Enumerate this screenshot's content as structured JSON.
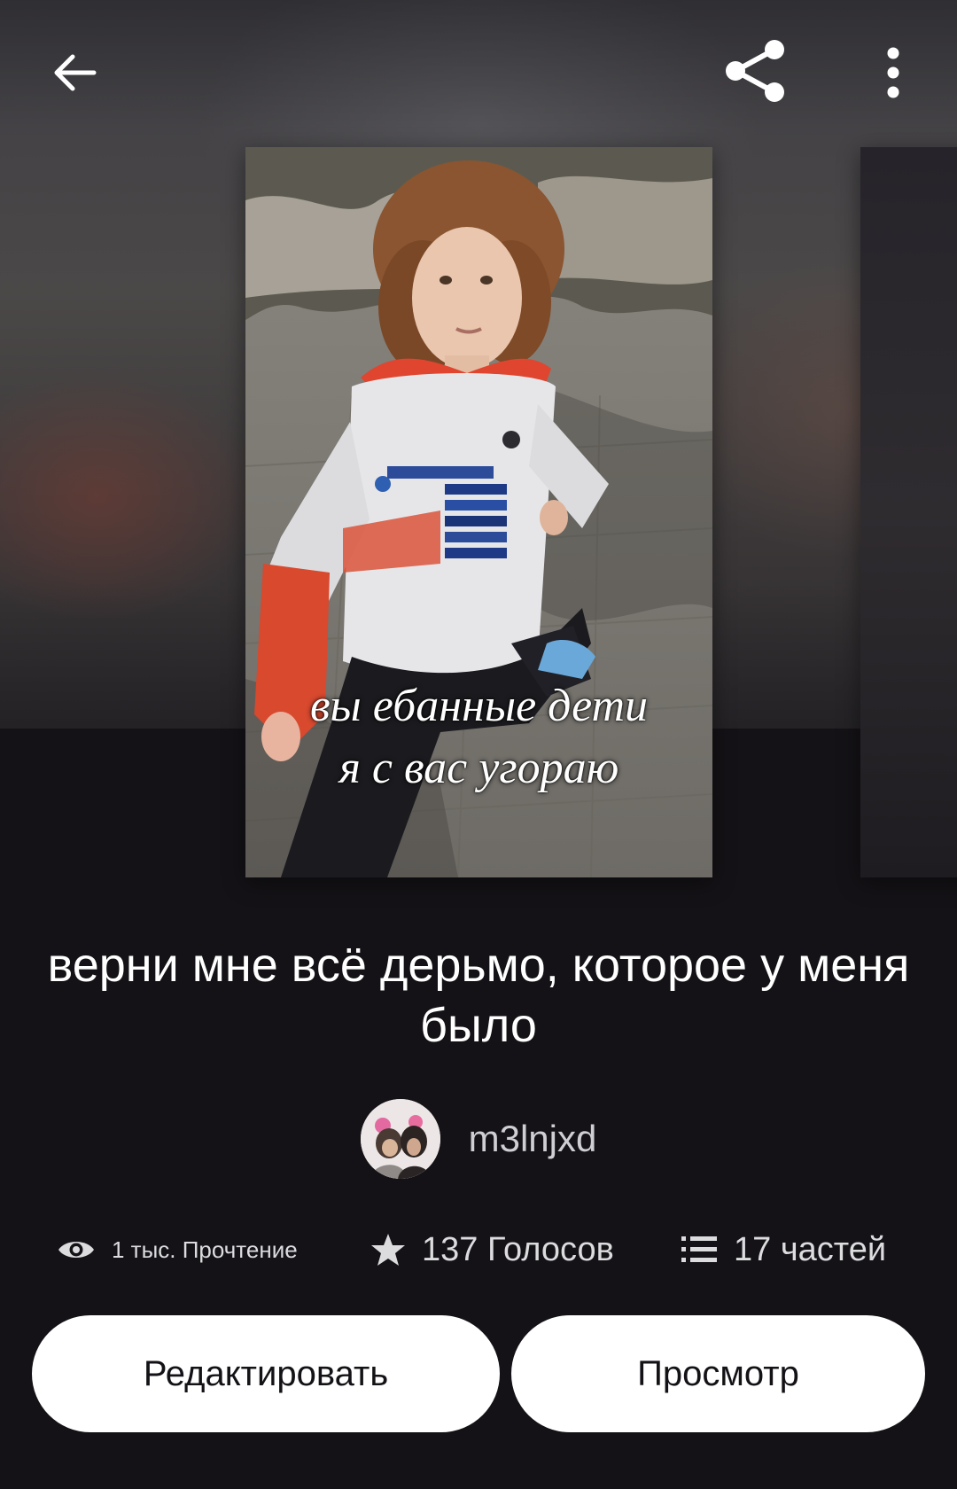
{
  "story": {
    "title": "верни мне всё дерьмо, которое у меня было",
    "cover_caption_line1": "вы ебанные дети",
    "cover_caption_line2": "я с вас угораю"
  },
  "author": {
    "name": "m3lnjxd"
  },
  "stats": {
    "reads": "1 тыс. Прочтение",
    "votes": "137 Голосов",
    "parts": "17 частей"
  },
  "actions": {
    "edit_label": "Редактировать",
    "view_label": "Просмотр"
  },
  "icons": {
    "back": "arrow-left-icon",
    "share": "share-icon",
    "more": "more-vertical-icon",
    "reads": "eye-icon",
    "votes": "star-icon",
    "parts": "list-icon"
  },
  "colors": {
    "background": "#141216",
    "button_bg": "#ffffff",
    "button_text": "#141216",
    "text_primary": "#ffffff",
    "text_secondary": "#dcdcdf"
  }
}
